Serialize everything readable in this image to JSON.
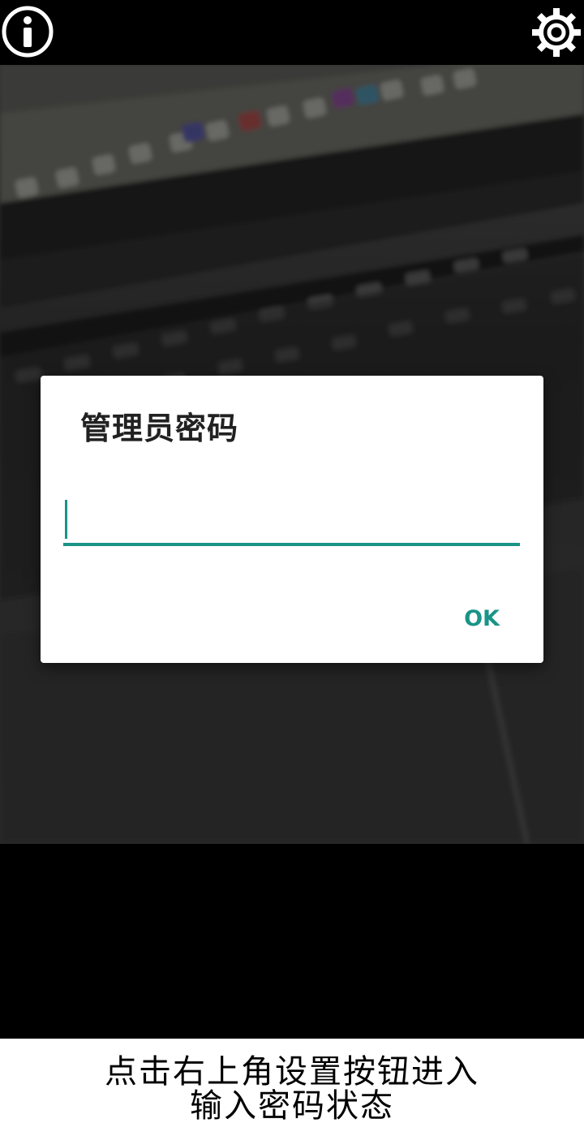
{
  "topbar": {
    "info_icon": "info-circle-icon",
    "settings_icon": "gear-icon"
  },
  "dialog": {
    "title": "管理员密码",
    "password_value": "",
    "ok_label": "OK",
    "accent_color": "#1a9487"
  },
  "caption": {
    "line1": "点击右上角设置按钮进入",
    "line2": "输入密码状态"
  }
}
